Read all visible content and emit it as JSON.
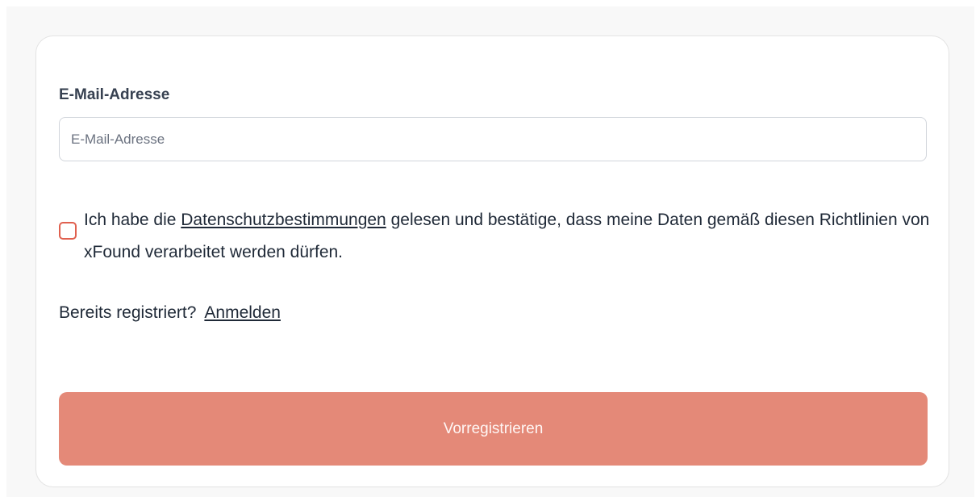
{
  "form": {
    "email_label": "E-Mail-Adresse",
    "email_placeholder": "E-Mail-Adresse",
    "email_value": "",
    "consent": {
      "checked": false,
      "text_before": "Ich habe die ",
      "link_text": "Datenschutzbestimmungen",
      "text_after": " gelesen und bestätige, dass meine Daten gemäß diesen Richtlinien von xFound verarbeitet werden dürfen."
    },
    "login": {
      "prompt": "Bereits registriert?",
      "link_text": "Anmelden"
    },
    "submit_label": "Vorregistrieren"
  },
  "colors": {
    "accent": "#e0604f",
    "button_bg": "#e48978",
    "page_bg": "#f8f8f8",
    "card_border": "#e3e3e3"
  }
}
